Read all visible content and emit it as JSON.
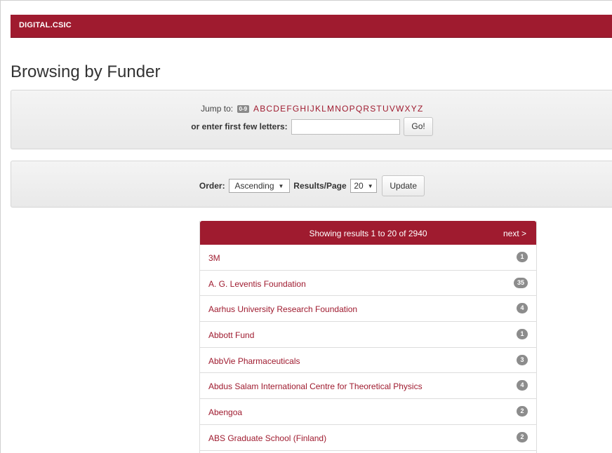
{
  "header": {
    "brand": "DIGITAL.CSIC"
  },
  "page_title": "Browsing by Funder",
  "jump": {
    "label": "Jump to:",
    "digits_badge": "0-9",
    "letters": [
      "A",
      "B",
      "C",
      "D",
      "E",
      "F",
      "G",
      "H",
      "I",
      "J",
      "K",
      "L",
      "M",
      "N",
      "O",
      "P",
      "Q",
      "R",
      "S",
      "T",
      "U",
      "V",
      "W",
      "X",
      "Y",
      "Z"
    ],
    "enter_label": "or enter first few letters:",
    "input_value": "",
    "go_label": "Go!"
  },
  "order": {
    "order_label": "Order:",
    "order_value": "Ascending",
    "rpp_label": "Results/Page",
    "rpp_value": "20",
    "update_label": "Update"
  },
  "results": {
    "summary": "Showing results 1 to 20 of 2940",
    "next_label": "next >",
    "items": [
      {
        "name": "3M",
        "count": "1"
      },
      {
        "name": "A. G. Leventis Foundation",
        "count": "35"
      },
      {
        "name": "Aarhus University Research Foundation",
        "count": "4"
      },
      {
        "name": "Abbott Fund",
        "count": "1"
      },
      {
        "name": "AbbVie Pharmaceuticals",
        "count": "3"
      },
      {
        "name": "Abdus Salam International Centre for Theoretical Physics",
        "count": "4"
      },
      {
        "name": "Abengoa",
        "count": "2"
      },
      {
        "name": "ABS Graduate School (Finland)",
        "count": "2"
      }
    ]
  },
  "colors": {
    "accent": "#9f1b2f",
    "badge": "#8c8c8c"
  }
}
